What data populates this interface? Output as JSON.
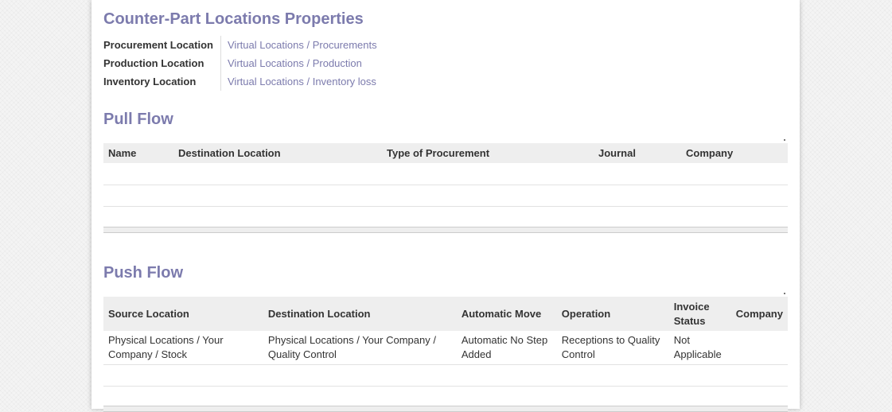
{
  "counterpart": {
    "title": "Counter-Part Locations Properties",
    "fields": [
      {
        "label": "Procurement Location",
        "value": "Virtual Locations / Procurements"
      },
      {
        "label": "Production Location",
        "value": "Virtual Locations / Production"
      },
      {
        "label": "Inventory Location",
        "value": "Virtual Locations / Inventory loss"
      }
    ]
  },
  "pull_flow": {
    "title": "Pull Flow",
    "columns": [
      "Name",
      "Destination Location",
      "Type of Procurement",
      "Journal",
      "Company"
    ],
    "rows": []
  },
  "push_flow": {
    "title": "Push Flow",
    "columns": [
      "Source Location",
      "Destination Location",
      "Automatic Move",
      "Operation",
      "Invoice Status",
      "Company"
    ],
    "rows": [
      {
        "source_location": "Physical Locations / Your Company / Stock",
        "destination_location": "Physical Locations / Your Company / Quality Control",
        "automatic_move": "Automatic No Step Added",
        "operation": "Receptions to Quality Control",
        "invoice_status": "Not Applicable",
        "company": ""
      }
    ]
  },
  "colors": {
    "accent": "#7c7bad",
    "header_bg": "#eeeeee",
    "text": "#333333"
  }
}
